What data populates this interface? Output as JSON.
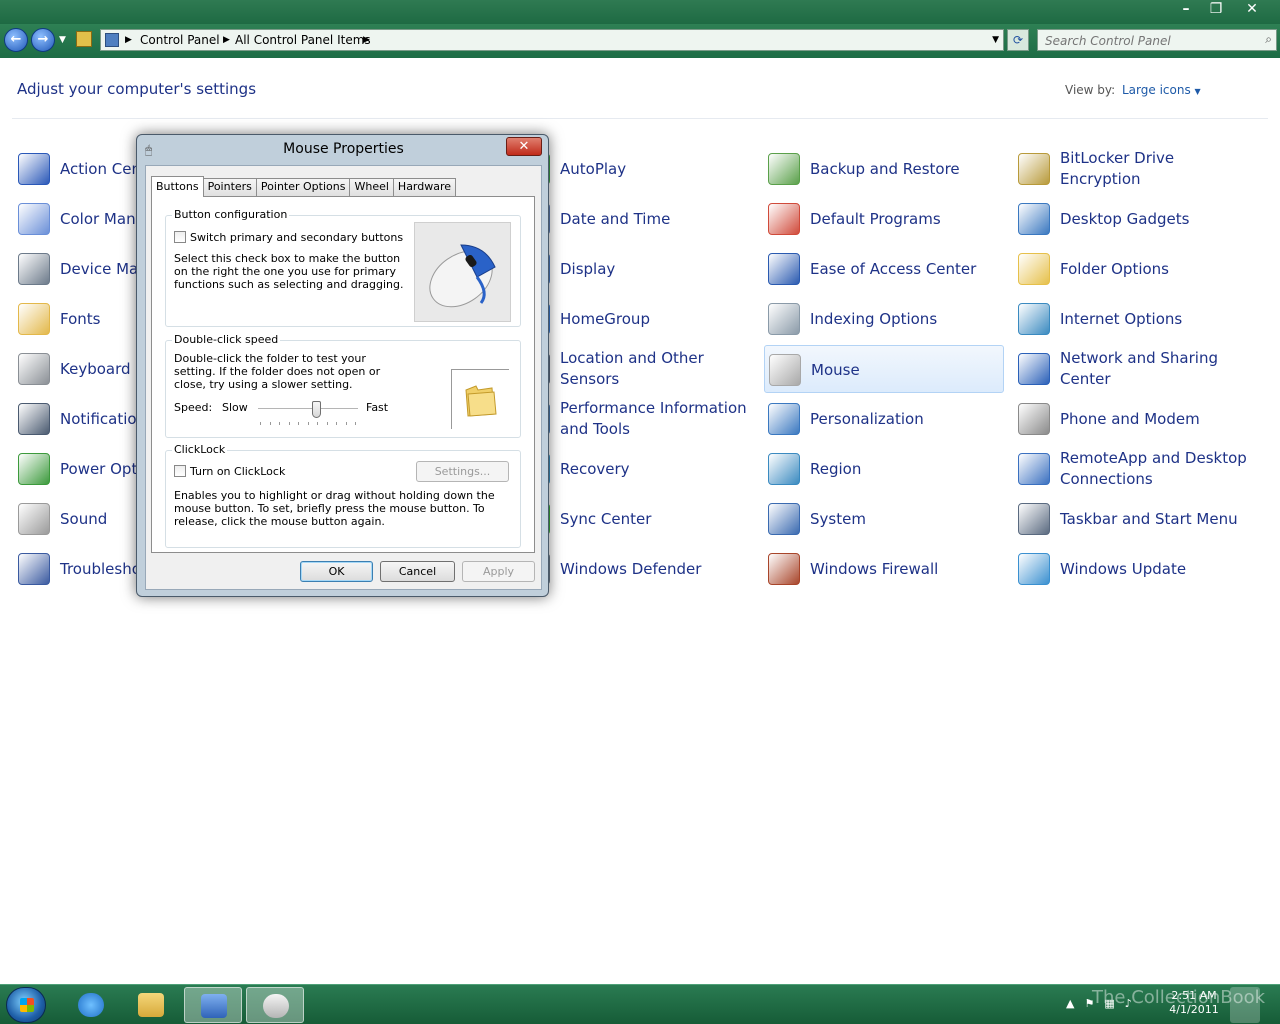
{
  "window": {
    "caption_buttons": [
      "minimize-icon",
      "restore-icon",
      "close-icon"
    ]
  },
  "address": {
    "crumbs": [
      "Control Panel",
      "All Control Panel Items"
    ],
    "search_placeholder": "Search Control Panel"
  },
  "header": {
    "title": "Adjust your computer's settings",
    "view_by_label": "View by:",
    "view_by_value": "Large icons"
  },
  "items": [
    {
      "label": "Action Center",
      "icon": "flag-icon",
      "color": "#2a58b8"
    },
    {
      "label": "Color Management",
      "icon": "color-management-icon",
      "color": "#6a8fd8"
    },
    {
      "label": "Device Manager",
      "icon": "device-manager-icon",
      "color": "#6c7a8a"
    },
    {
      "label": "Fonts",
      "icon": "fonts-icon",
      "color": "#e3b84a"
    },
    {
      "label": "Keyboard",
      "icon": "keyboard-icon",
      "color": "#8a8f95"
    },
    {
      "label": "Notification Area Icons",
      "icon": "notification-icon",
      "color": "#4a5a70"
    },
    {
      "label": "Power Options",
      "icon": "battery-icon",
      "color": "#3c9a3c"
    },
    {
      "label": "Sound",
      "icon": "speaker-icon",
      "color": "#9a9a9a"
    },
    {
      "label": "Troubleshooting",
      "icon": "troubleshoot-icon",
      "color": "#3a5aa0"
    },
    {
      "label": "AutoPlay",
      "icon": "autoplay-icon",
      "color": "#3ca048"
    },
    {
      "label": "Date and Time",
      "icon": "clock-icon",
      "color": "#5a7ab0"
    },
    {
      "label": "Display",
      "icon": "display-icon",
      "color": "#4a7ac0"
    },
    {
      "label": "HomeGroup",
      "icon": "homegroup-icon",
      "color": "#3a7ad0"
    },
    {
      "label": "Location and Other Sensors",
      "icon": "sensors-icon",
      "color": "#5a6a80"
    },
    {
      "label": "Performance Information and Tools",
      "icon": "performance-icon",
      "color": "#4a7ab0"
    },
    {
      "label": "Recovery",
      "icon": "recovery-icon",
      "color": "#3a90c0"
    },
    {
      "label": "Sync Center",
      "icon": "sync-icon",
      "color": "#3caa3c"
    },
    {
      "label": "Windows Defender",
      "icon": "defender-icon",
      "color": "#6a7a8a"
    },
    {
      "label": "Backup and Restore",
      "icon": "backup-icon",
      "color": "#5aa04a"
    },
    {
      "label": "Default Programs",
      "icon": "default-programs-icon",
      "color": "#d04a3a"
    },
    {
      "label": "Ease of Access Center",
      "icon": "ease-of-access-icon",
      "color": "#2a5ab0"
    },
    {
      "label": "Indexing Options",
      "icon": "indexing-icon",
      "color": "#8a9aa8"
    },
    {
      "label": "Mouse",
      "icon": "mouse-icon",
      "color": "#a8a8a8"
    },
    {
      "label": "Personalization",
      "icon": "personalization-icon",
      "color": "#3a78c0"
    },
    {
      "label": "Region",
      "icon": "globe-icon",
      "color": "#3a8ac0"
    },
    {
      "label": "System",
      "icon": "system-icon",
      "color": "#3a6ab0"
    },
    {
      "label": "Windows Firewall",
      "icon": "firewall-icon",
      "color": "#a8452a"
    },
    {
      "label": "BitLocker Drive Encryption",
      "icon": "bitlocker-icon",
      "color": "#b89a3a"
    },
    {
      "label": "Desktop Gadgets",
      "icon": "gadgets-icon",
      "color": "#3a78c0"
    },
    {
      "label": "Folder Options",
      "icon": "folder-icon",
      "color": "#e6c04a"
    },
    {
      "label": "Internet Options",
      "icon": "internet-options-icon",
      "color": "#3a8ac0"
    },
    {
      "label": "Network and Sharing Center",
      "icon": "network-icon",
      "color": "#2a60b8"
    },
    {
      "label": "Phone and Modem",
      "icon": "phone-icon",
      "color": "#8a8a8a"
    },
    {
      "label": "RemoteApp and Desktop Connections",
      "icon": "remoteapp-icon",
      "color": "#3a70c0"
    },
    {
      "label": "Taskbar and Start Menu",
      "icon": "taskbar-icon",
      "color": "#5a6a80"
    },
    {
      "label": "Windows Update",
      "icon": "windows-update-icon",
      "color": "#3a90d0"
    }
  ],
  "dialog": {
    "title": "Mouse Properties",
    "tabs": [
      "Buttons",
      "Pointers",
      "Pointer Options",
      "Wheel",
      "Hardware"
    ],
    "button_config": {
      "title": "Button configuration",
      "checkbox_label": "Switch primary and secondary buttons",
      "description": "Select this check box to make the button on the right the one you use for primary functions such as selecting and dragging."
    },
    "double_click": {
      "title": "Double-click speed",
      "description": "Double-click the folder to test your setting. If the folder does not open or close, try using a slower setting.",
      "speed_label": "Speed:",
      "slow_label": "Slow",
      "fast_label": "Fast"
    },
    "clicklock": {
      "title": "ClickLock",
      "checkbox_label": "Turn on ClickLock",
      "settings_label": "Settings...",
      "description": "Enables you to highlight or drag without holding down the mouse button. To set, briefly press the mouse button. To release, click the mouse button again."
    },
    "buttons": {
      "ok": "OK",
      "cancel": "Cancel",
      "apply": "Apply"
    }
  },
  "taskbar": {
    "time": "2:51 AM",
    "date": "4/1/2011",
    "watermark": "The CollectionBook"
  }
}
